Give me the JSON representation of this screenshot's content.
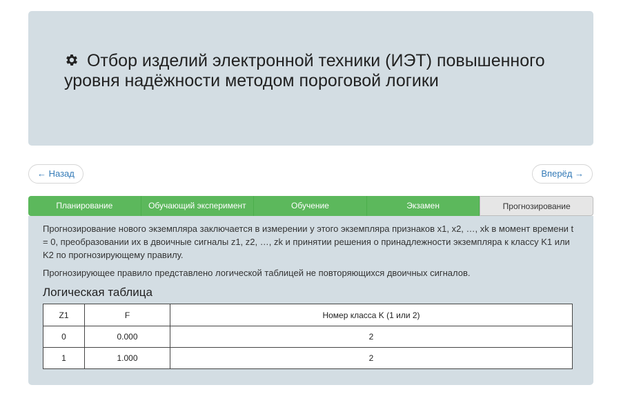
{
  "header": {
    "title": "Отбор изделий электронной техники (ИЭТ) повышенного уровня надёжности методом пороговой логики",
    "icon": "gear-icon"
  },
  "pager": {
    "prev_label": "← Назад",
    "next_label": "Вперёд →"
  },
  "tabs": [
    {
      "label": "Планирование",
      "active": false
    },
    {
      "label": "Обучающий эксперимент",
      "active": false
    },
    {
      "label": "Обучение",
      "active": false
    },
    {
      "label": "Экзамен",
      "active": false
    },
    {
      "label": "Прогнозирование",
      "active": true
    }
  ],
  "colors": {
    "tab_done": "#5cb85c",
    "tab_active": "#e6e6e6",
    "panel_bg": "#d3dde3",
    "link": "#337ab7"
  },
  "content": {
    "paragraph1": "Прогнозирование нового экземпляра заключается в измерении у этого экземпляра признаков x1, x2, …, xk в момент времени t = 0, преобразовании их в двоичные сигналы z1, z2, …, zk и принятии решения о принадлежности экземпляра к классу K1 или K2 по прогнозирующему правилу.",
    "paragraph2": "Прогнозирующее правило представлено логической таблицей не повторяющихся двоичных сигналов.",
    "table_title": "Логическая таблица"
  },
  "table": {
    "headers": [
      "Z1",
      "F",
      "Номер класса K (1 или 2)"
    ],
    "rows": [
      [
        "0",
        "0.000",
        "2"
      ],
      [
        "1",
        "1.000",
        "2"
      ]
    ]
  }
}
